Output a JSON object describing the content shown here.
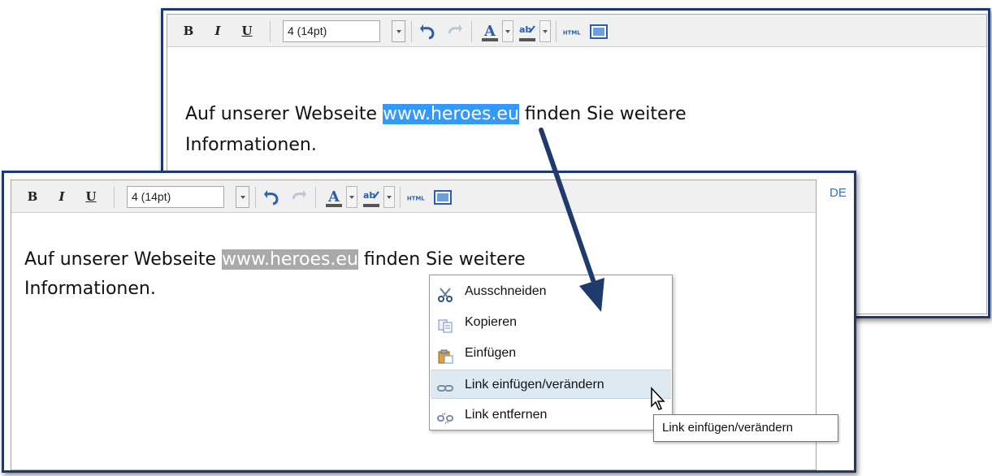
{
  "toolbar": {
    "bold": "B",
    "italic": "I",
    "underline": "U",
    "font_size": "4 (14pt)",
    "html_label": "HTML"
  },
  "editor_text": {
    "before": "Auf unserer Webseite ",
    "link": "www.heroes.eu",
    "after_line1": " finden Sie weitere",
    "line2": "Informationen."
  },
  "language": "DE",
  "context_menu": {
    "items": [
      {
        "label": "Ausschneiden",
        "icon": "scissors-icon"
      },
      {
        "label": "Kopieren",
        "icon": "copy-icon"
      },
      {
        "label": "Einfügen",
        "icon": "paste-icon"
      },
      {
        "label": "Link einfügen/verändern",
        "icon": "link-icon",
        "highlighted": true
      },
      {
        "label": "Link entfernen",
        "icon": "unlink-icon"
      }
    ]
  },
  "tooltip": "Link einfügen/verändern",
  "colors": {
    "panel_border": "#1f3a6d",
    "selection_blue": "#3399ff",
    "selection_grey": "#a9a9a9",
    "menu_highlight": "#dfe9f2",
    "arrow": "#1f3a6d"
  }
}
